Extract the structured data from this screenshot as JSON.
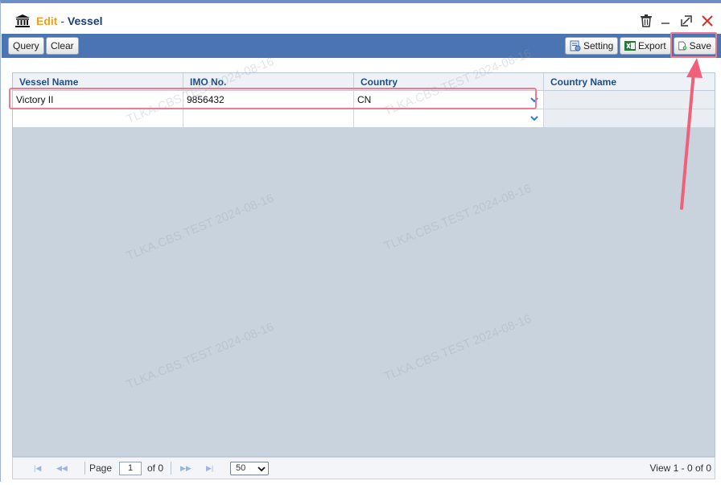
{
  "window": {
    "mode": "Edit",
    "separator": " - ",
    "title": "Vessel"
  },
  "toolbar": {
    "query_label": "Query",
    "clear_label": "Clear",
    "setting_label": "Setting",
    "export_label": "Export",
    "save_label": "Save"
  },
  "grid": {
    "columns": [
      "Vessel Name",
      "IMO No.",
      "Country",
      "Country Name"
    ],
    "rows": [
      {
        "vessel_name": "Victory II",
        "imo_no": "9856432",
        "country": "CN",
        "country_name": ""
      },
      {
        "vessel_name": "",
        "imo_no": "",
        "country": "",
        "country_name": ""
      }
    ]
  },
  "pager": {
    "page_label": "Page",
    "page_value": "1",
    "of_label": "of 0",
    "page_size": "50",
    "view_text": "View 1 - 0 of 0"
  },
  "watermark": "TLKA.CBS.TEST 2024-08-16",
  "colors": {
    "toolbar_bg": "#4a74b2",
    "title_mode": "#f0a020",
    "title_text": "#1a3c7a",
    "annotation": "#f0607a",
    "grid_body": "#c9d3dd"
  }
}
